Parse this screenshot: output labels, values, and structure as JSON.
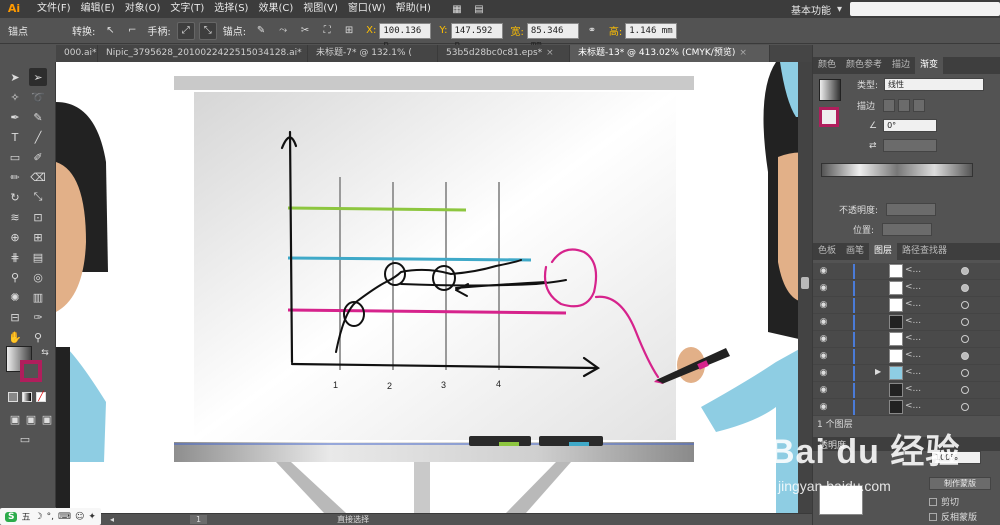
{
  "menubar": {
    "logo": "Ai",
    "items": [
      "文件(F)",
      "编辑(E)",
      "对象(O)",
      "文字(T)",
      "选择(S)",
      "效果(C)",
      "视图(V)",
      "窗口(W)",
      "帮助(H)"
    ],
    "workspace": "基本功能"
  },
  "controlbar": {
    "anchor_label": "锚点",
    "convert_label": "转换:",
    "handles_label": "手柄:",
    "anchors_label": "锚点:",
    "x_key": "X:",
    "x_value": "100.136 p",
    "y_key": "Y:",
    "y_value": "147.592 p",
    "w_key": "宽:",
    "w_value": "85.346 mm",
    "h_key": "高:",
    "h_value": "1.146 mm"
  },
  "tabs": [
    {
      "label": "000.ai*"
    },
    {
      "label": "Nipic_3795628_20100224225150341​28.ai*"
    },
    {
      "label": "未标题-7* @ 132.1% ("
    },
    {
      "label": "53b5d28bc0c81.eps*"
    },
    {
      "label": "未标题-13* @ 413.02% (CMYK/预览)",
      "active": true
    }
  ],
  "canvas": {
    "x_ticks": [
      "1",
      "2",
      "3",
      "4"
    ]
  },
  "panel_top": {
    "tabs": [
      "颜色",
      "颜色参考",
      "描边",
      "渐变"
    ],
    "active_tab": "渐变",
    "type_label": "类型:",
    "type_value": "线性",
    "stroke_label": "描边",
    "angle_value": "0°",
    "opacity_label": "不透明度:",
    "position_label": "位置:"
  },
  "panel_layers": {
    "tabs": [
      "色板",
      "画笔",
      "图层",
      "路径查找器"
    ],
    "active_tab": "图层",
    "rows": [
      {
        "name": "<..."
      },
      {
        "name": "<..."
      },
      {
        "name": "<..."
      },
      {
        "name": "<..."
      },
      {
        "name": "<..."
      },
      {
        "name": "<..."
      },
      {
        "name": "<..."
      },
      {
        "name": "<..."
      },
      {
        "name": "<..."
      }
    ],
    "count_label": "1 个图层"
  },
  "panel_bottom": {
    "title": "透明度",
    "percent": "100%",
    "make_mask": "制作蒙版",
    "clip": "剪切",
    "invert_mask": "反相蒙版"
  },
  "statusbar": {
    "zoom_page": "1",
    "tool_label": "直接选择"
  },
  "ime": {
    "label": "五"
  },
  "watermark": {
    "brand": "Bai du 经验",
    "url": "jingyan.baidu.com"
  },
  "colors": {
    "chart_green": "#8dc63f",
    "chart_blue": "#3fa9c8",
    "chart_magenta": "#d6238c",
    "skin": "#e2b088",
    "hair": "#222222",
    "sleeve": "#8ecde3"
  }
}
